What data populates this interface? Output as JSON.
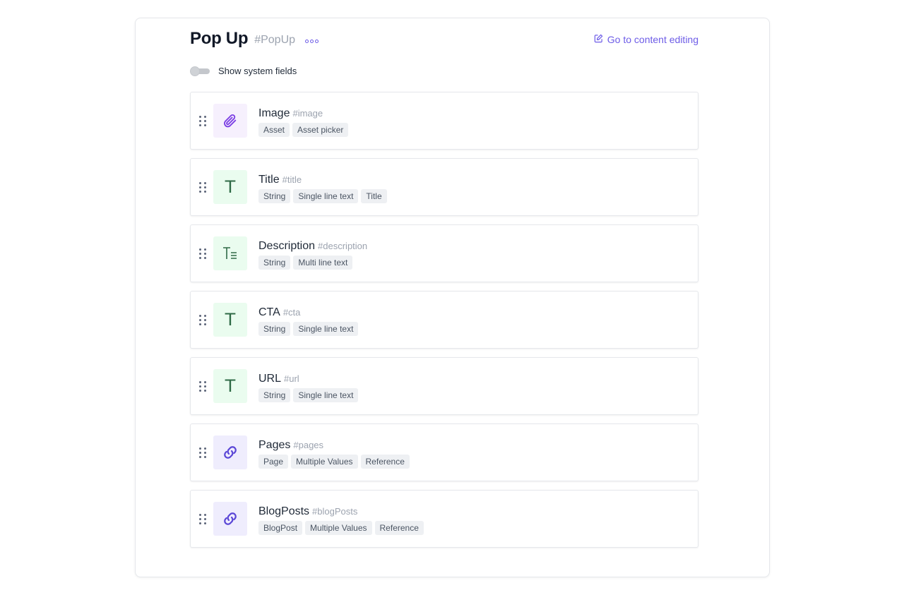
{
  "header": {
    "title": "Pop Up",
    "api_id": "#PopUp",
    "edit_link_label": "Go to content editing"
  },
  "toggle": {
    "label": "Show system fields",
    "enabled": false
  },
  "colors": {
    "accent": "#6d5ce7",
    "text_icon": "#2f6a46",
    "asset_bg": "#f6f0fd",
    "text_bg": "#eafcef",
    "ref_bg": "#efedfd"
  },
  "fields": [
    {
      "name": "Image",
      "api_id": "#image",
      "icon": "paperclip-icon",
      "tags": [
        "Asset",
        "Asset picker"
      ]
    },
    {
      "name": "Title",
      "api_id": "#title",
      "icon": "single-line-text-icon",
      "tags": [
        "String",
        "Single line text",
        "Title"
      ]
    },
    {
      "name": "Description",
      "api_id": "#description",
      "icon": "multi-line-text-icon",
      "tags": [
        "String",
        "Multi line text"
      ]
    },
    {
      "name": "CTA",
      "api_id": "#cta",
      "icon": "single-line-text-icon",
      "tags": [
        "String",
        "Single line text"
      ]
    },
    {
      "name": "URL",
      "api_id": "#url",
      "icon": "single-line-text-icon",
      "tags": [
        "String",
        "Single line text"
      ]
    },
    {
      "name": "Pages",
      "api_id": "#pages",
      "icon": "link-icon",
      "tags": [
        "Page",
        "Multiple Values",
        "Reference"
      ]
    },
    {
      "name": "BlogPosts",
      "api_id": "#blogPosts",
      "icon": "link-icon",
      "tags": [
        "BlogPost",
        "Multiple Values",
        "Reference"
      ]
    }
  ]
}
